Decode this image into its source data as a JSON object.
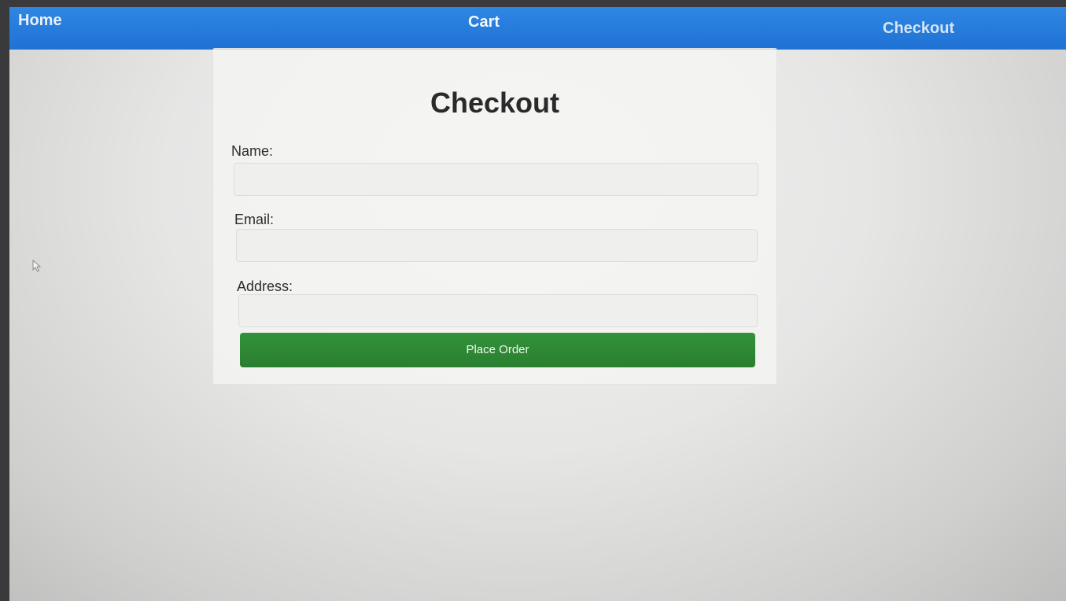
{
  "nav": {
    "home_label": "Home",
    "cart_label": "Cart",
    "checkout_label": "Checkout"
  },
  "page": {
    "title": "Checkout"
  },
  "form": {
    "name_label": "Name:",
    "name_value": "",
    "email_label": "Email:",
    "email_value": "",
    "address_label": "Address:",
    "address_value": "",
    "submit_label": "Place Order"
  },
  "colors": {
    "navbar": "#1f72d4",
    "button": "#2a7f30"
  },
  "icons": {
    "cursor": "pointer-arrow-icon"
  }
}
